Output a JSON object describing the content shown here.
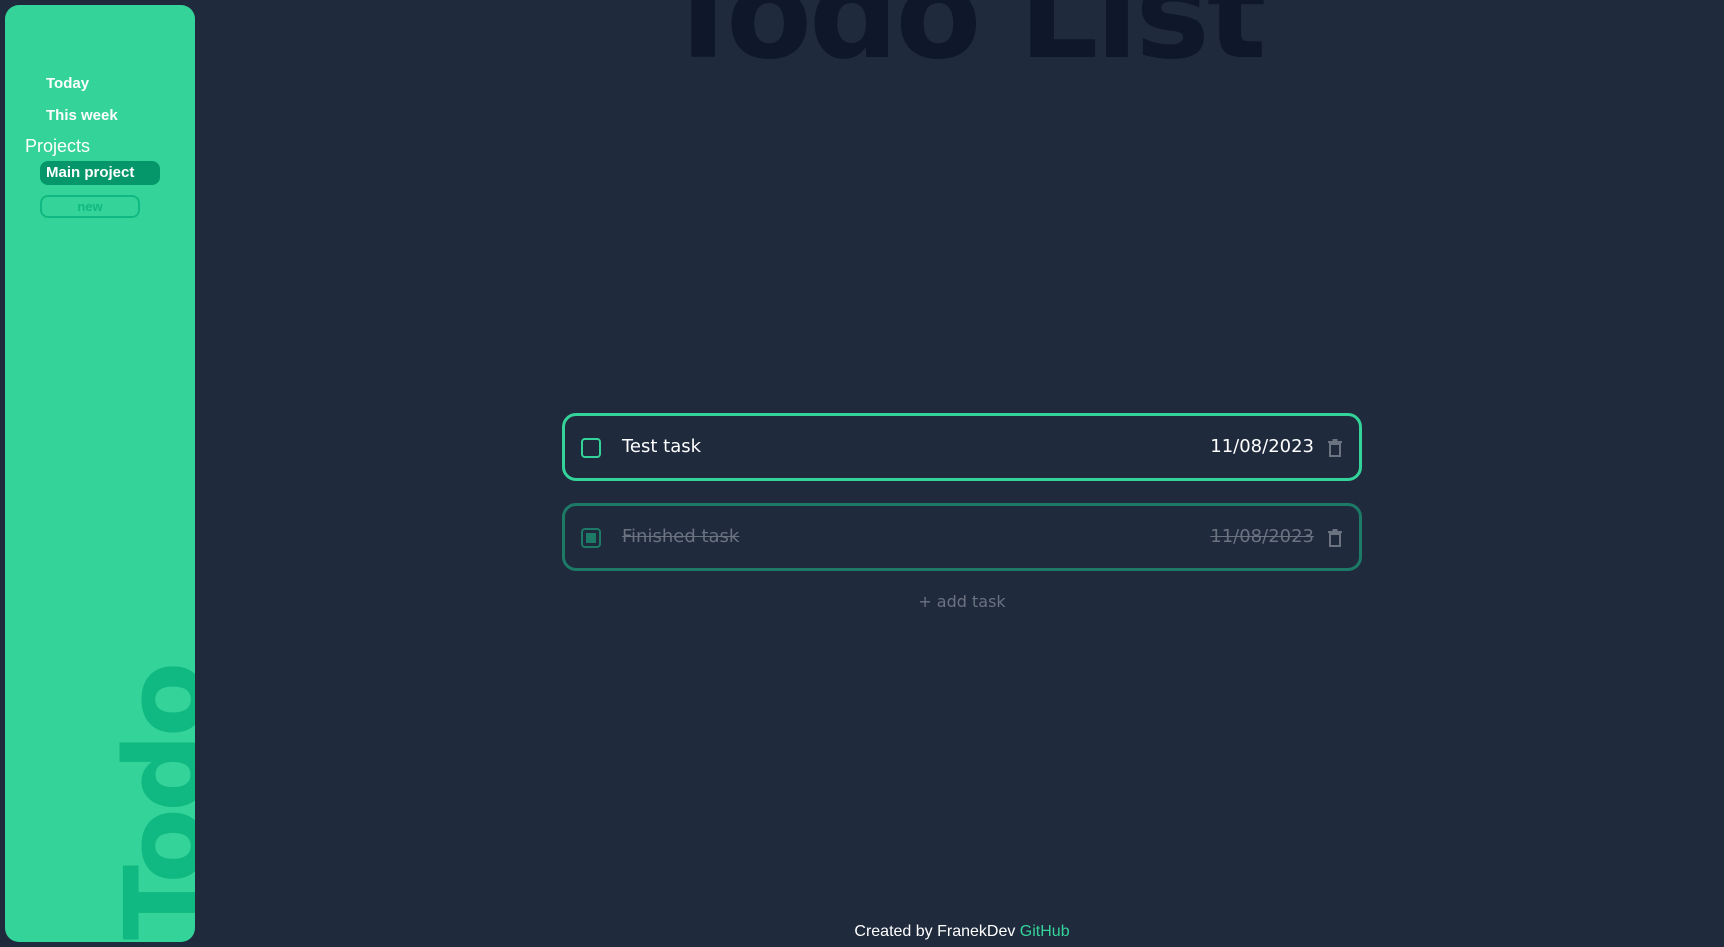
{
  "app": {
    "title": "Todo List",
    "brand": "Todo"
  },
  "sidebar": {
    "nav": [
      {
        "label": "Today"
      },
      {
        "label": "This week"
      }
    ],
    "projects_heading": "Projects",
    "projects": [
      {
        "label": "Main project",
        "active": true
      }
    ],
    "new_project_label": "new"
  },
  "tasks": [
    {
      "name": "Test task",
      "date": "11/08/2023",
      "completed": false
    },
    {
      "name": "Finished task",
      "date": "11/08/2023",
      "completed": true
    }
  ],
  "add_task_label": "+ add task",
  "footer": {
    "text": "Created by FranekDev",
    "link_label": "GitHub"
  },
  "colors": {
    "background": "#1f2a3d",
    "accent": "#34d399",
    "accent_dark": "#059669",
    "muted": "#6b7280"
  },
  "icons": {
    "delete": "trash-icon",
    "checkbox": "checkbox-icon"
  }
}
